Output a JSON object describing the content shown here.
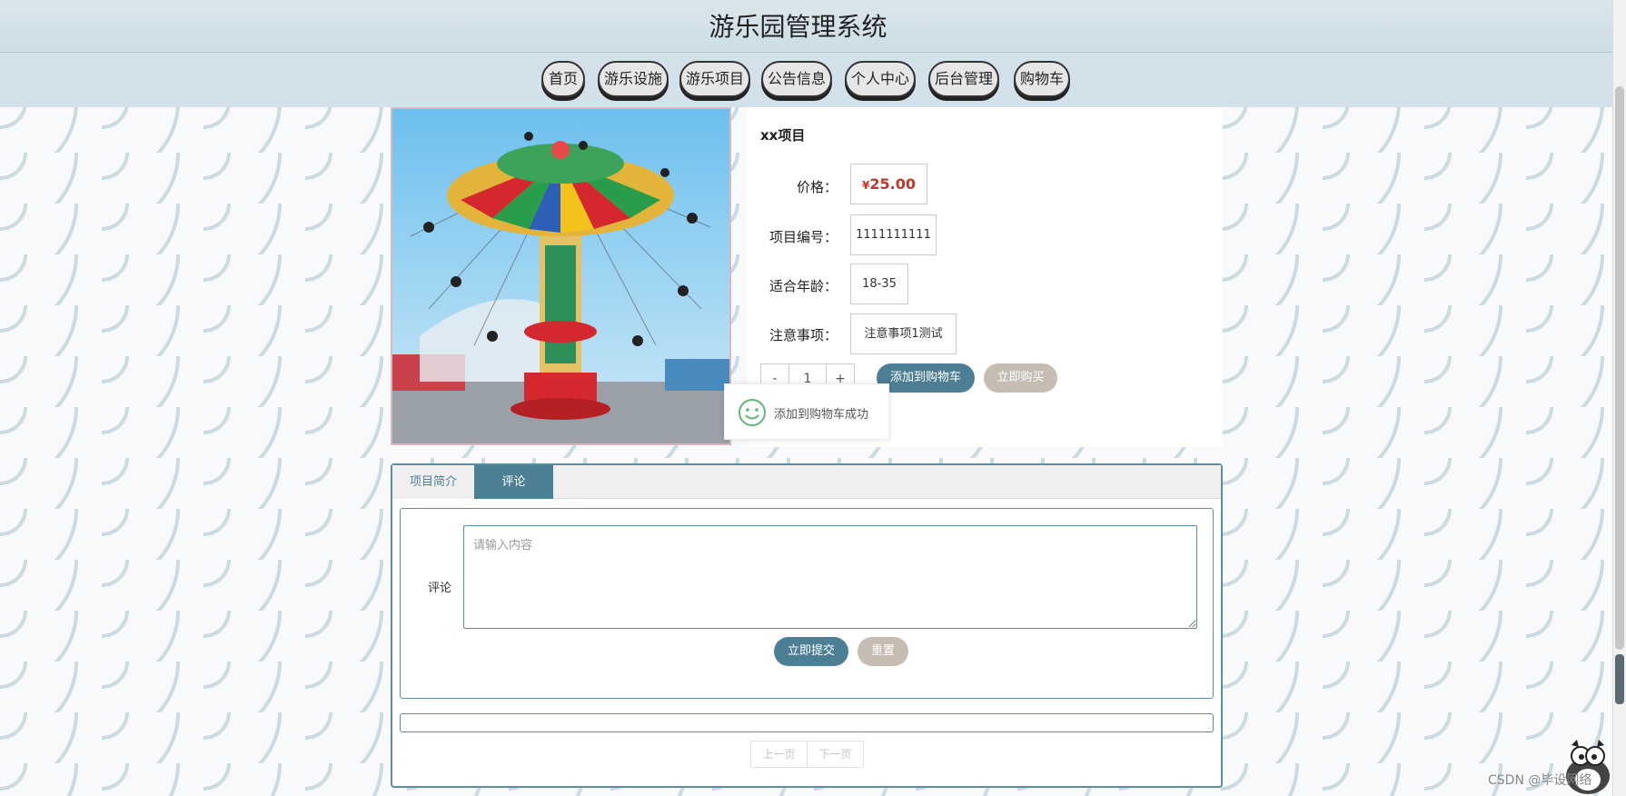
{
  "header": {
    "title": "游乐园管理系统"
  },
  "nav": {
    "items": [
      "首页",
      "游乐设施",
      "游乐项目",
      "公告信息",
      "个人中心",
      "后台管理",
      "购物车"
    ]
  },
  "product": {
    "name": "xx项目",
    "price_label": "价格：",
    "currency": "¥",
    "price": "25.00",
    "code_label": "项目编号：",
    "code": "1111111111",
    "age_label": "适合年龄：",
    "age": "18-35",
    "notes_label": "注意事项：",
    "notes": "注意事项1测试",
    "qty_minus": "-",
    "qty": "1",
    "qty_plus": "+",
    "add_cart_label": "添加到购物车",
    "buy_now_label": "立即购买"
  },
  "toast": {
    "message": "添加到购物车成功"
  },
  "tabs": {
    "items": [
      {
        "label": "项目简介",
        "active": false
      },
      {
        "label": "评论",
        "active": true
      }
    ]
  },
  "comment": {
    "label": "评论",
    "placeholder": "请输入内容",
    "submit_label": "立即提交",
    "reset_label": "重置"
  },
  "pager": {
    "prev": "上一页",
    "next": "下一页"
  },
  "watermark": "CSDN @毕设网络",
  "colors": {
    "accent": "#4d7f94",
    "secondary": "#c5bcb2",
    "price": "#c0392b"
  }
}
